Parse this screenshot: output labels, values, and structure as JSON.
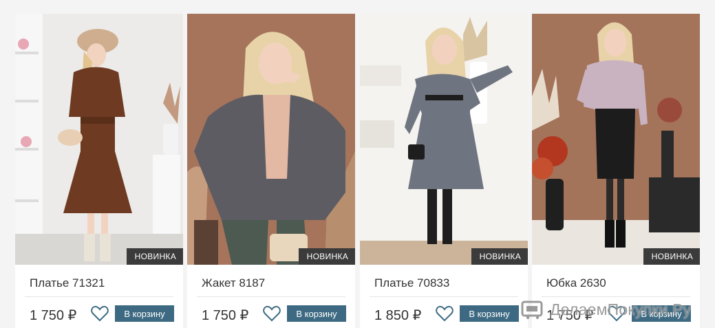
{
  "products": [
    {
      "name": "Платье 71321",
      "price": "1 750 ₽",
      "badge": "НОВИНКА",
      "cart_label": "В корзину",
      "image_alt": "Платье 71321"
    },
    {
      "name": "Жакет 8187",
      "price": "1 750 ₽",
      "badge": "НОВИНКА",
      "cart_label": "В корзину",
      "image_alt": "Жакет 8187"
    },
    {
      "name": "Платье 70833",
      "price": "1 850 ₽",
      "badge": "НОВИНКА",
      "cart_label": "В корзину",
      "image_alt": "Платье 70833"
    },
    {
      "name": "Юбка 2630",
      "price": "1 750 ₽",
      "badge": "НОВИНКА",
      "cart_label": "В корзину",
      "image_alt": "Юбка 2630"
    }
  ],
  "watermark": {
    "text": "ДелаемПокупки.Ру",
    "icon": "cart-logo-icon"
  },
  "colors": {
    "page_background": "#f4f4f4",
    "card_background": "#ffffff",
    "cart_button": "#3d6a82",
    "badge": "#3b3b3b",
    "heart": "#3d6a82"
  }
}
